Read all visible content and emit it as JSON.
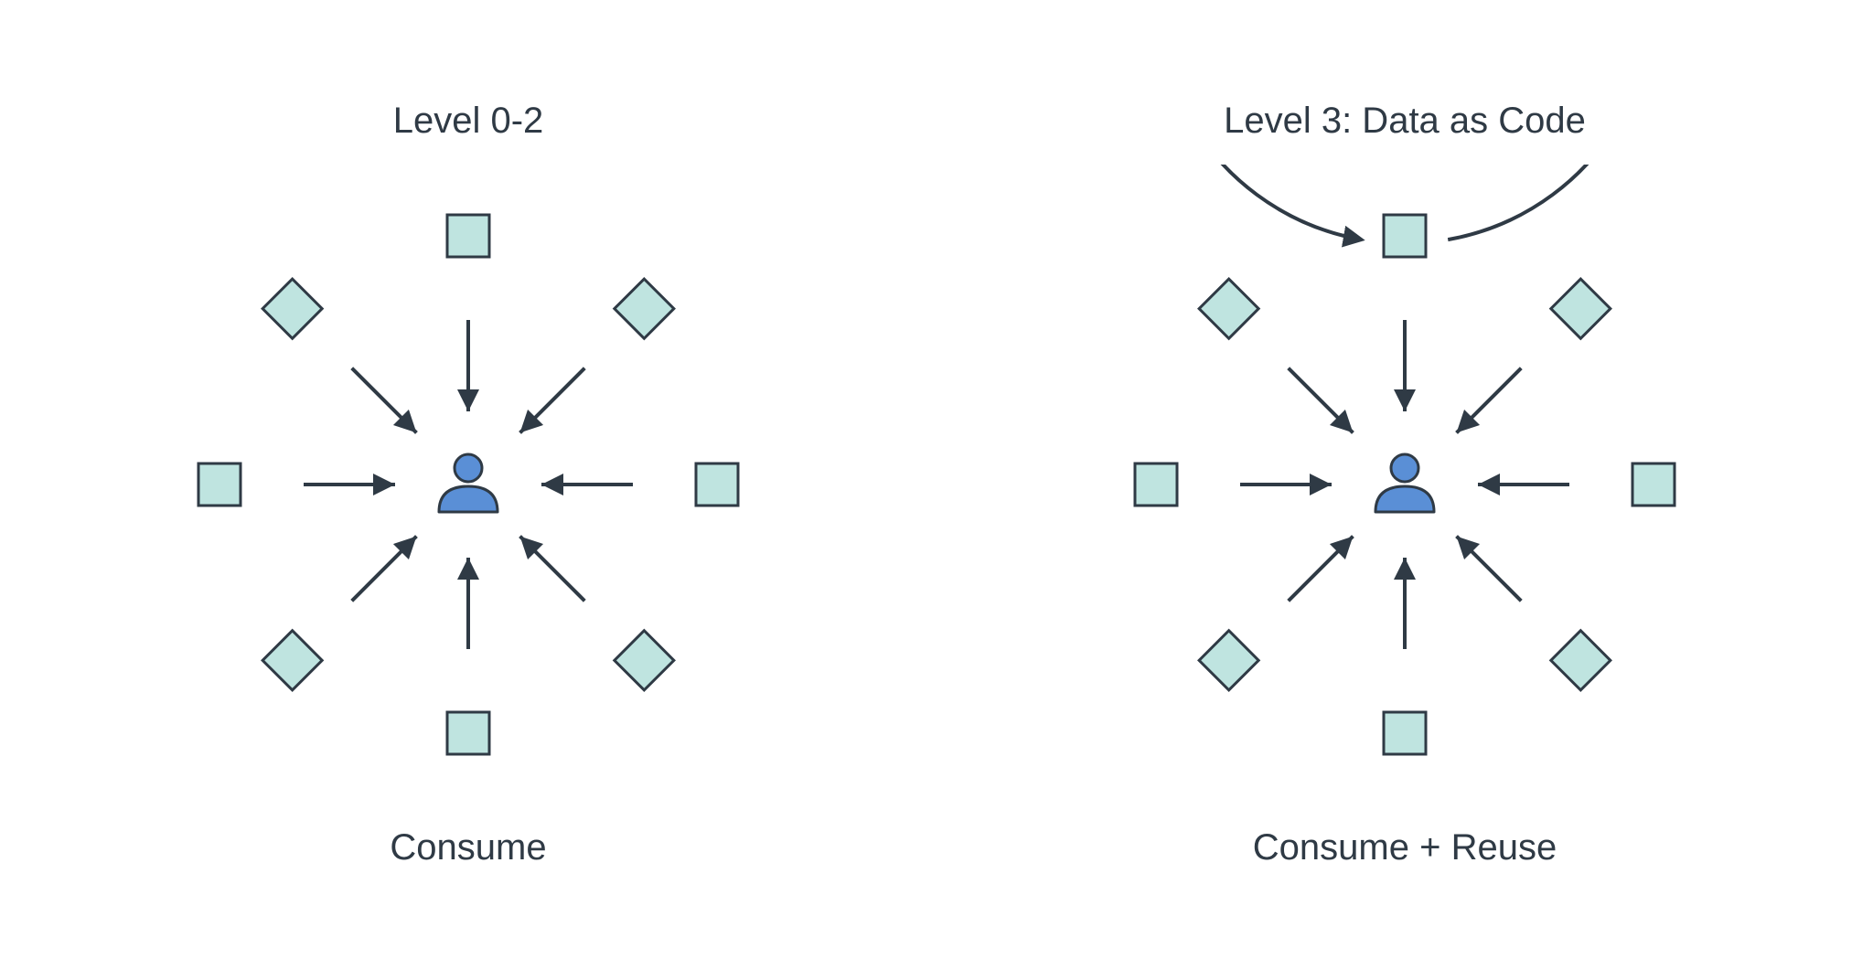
{
  "colors": {
    "shape_fill": "#bfe4e0",
    "shape_stroke": "#2f3a45",
    "person_fill": "#5a8fd6",
    "person_stroke": "#2f3a45",
    "arrow": "#2f3a45",
    "ring": "#2f3a45",
    "text": "#2f3a45"
  },
  "geometry": {
    "node_radius": 272,
    "arrow_inner_radius": 80,
    "arrow_outer_radius": 180,
    "square_size": 46,
    "diamond_size": 46,
    "arrow_stroke_width": 4,
    "ring_stroke_width": 4
  },
  "left": {
    "title": "Level 0-2",
    "caption": "Consume",
    "has_ring": false,
    "nodes": [
      {
        "angle": 0,
        "shape": "square"
      },
      {
        "angle": 45,
        "shape": "diamond"
      },
      {
        "angle": 90,
        "shape": "square"
      },
      {
        "angle": 135,
        "shape": "diamond"
      },
      {
        "angle": 180,
        "shape": "square"
      },
      {
        "angle": 225,
        "shape": "diamond"
      },
      {
        "angle": 270,
        "shape": "square"
      },
      {
        "angle": 315,
        "shape": "diamond"
      }
    ]
  },
  "right": {
    "title": "Level 3: Data as Code",
    "caption": "Consume + Reuse",
    "has_ring": true,
    "nodes": [
      {
        "angle": 0,
        "shape": "square"
      },
      {
        "angle": 45,
        "shape": "diamond"
      },
      {
        "angle": 90,
        "shape": "square"
      },
      {
        "angle": 135,
        "shape": "diamond"
      },
      {
        "angle": 180,
        "shape": "square"
      },
      {
        "angle": 225,
        "shape": "diamond"
      },
      {
        "angle": 270,
        "shape": "square"
      },
      {
        "angle": 315,
        "shape": "diamond"
      }
    ]
  }
}
